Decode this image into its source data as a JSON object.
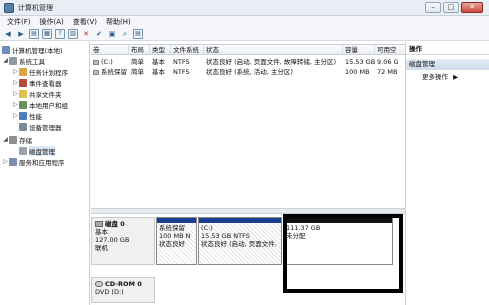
{
  "window": {
    "title": "计算机管理"
  },
  "menu": [
    "文件(F)",
    "操作(A)",
    "查看(V)",
    "帮助(H)"
  ],
  "toolbar_icons": [
    "back-icon",
    "forward-icon",
    "up-icon",
    "properties-icon",
    "help-icon",
    "grid-icon",
    "close-icon",
    "check-icon",
    "open-icon",
    "search-icon",
    "view-icon"
  ],
  "tree": [
    {
      "label": "计算机管理(本地)",
      "icon": "computer-icon"
    },
    {
      "label": "系统工具",
      "icon": "tools-icon"
    },
    {
      "label": "任务计划程序",
      "icon": "clock-icon"
    },
    {
      "label": "事件查看器",
      "icon": "event-icon"
    },
    {
      "label": "共享文件夹",
      "icon": "folder-icon"
    },
    {
      "label": "本地用户和组",
      "icon": "users-icon"
    },
    {
      "label": "性能",
      "icon": "performance-icon"
    },
    {
      "label": "设备管理器",
      "icon": "device-icon"
    },
    {
      "label": "存储",
      "icon": "storage-icon"
    },
    {
      "label": "磁盘管理",
      "icon": "disk-icon"
    },
    {
      "label": "服务和应用程序",
      "icon": "services-icon"
    }
  ],
  "columns": [
    "卷",
    "布局",
    "类型",
    "文件系统",
    "状态",
    "容量",
    "可用空"
  ],
  "volumes": [
    {
      "name": "(C:)",
      "layout": "简单",
      "type": "基本",
      "fs": "NTFS",
      "status": "状态良好 (启动, 页面文件, 故障转储, 主分区)",
      "capacity": "15.53 GB",
      "free": "9.06 G"
    },
    {
      "name": "系统保留",
      "layout": "简单",
      "type": "基本",
      "fs": "NTFS",
      "status": "状态良好 (系统, 活动, 主分区)",
      "capacity": "100 MB",
      "free": "72 MB"
    }
  ],
  "actions": {
    "title": "操作",
    "section": "磁盘管理",
    "more": "更多操作"
  },
  "disk0": {
    "name": "磁盘 0",
    "type": "基本",
    "size": "127.00 GB",
    "state": "联机",
    "partitions": [
      {
        "title": "系统保留",
        "line2": "100 MB N",
        "line3": "状态良好"
      },
      {
        "title": "(C:)",
        "line2": "15.53 GB NTFS",
        "line3": "状态良好 (启动, 页面文件,"
      },
      {
        "title": "",
        "line2": "111.37 GB",
        "line3": "未分配"
      }
    ]
  },
  "cdrom0": {
    "name": "CD-ROM 0",
    "type": "DVD (D:)"
  },
  "colors": {
    "primary_bar": "#1c3f94",
    "unallocated_bar": "#111111",
    "highlight": "#000000"
  }
}
